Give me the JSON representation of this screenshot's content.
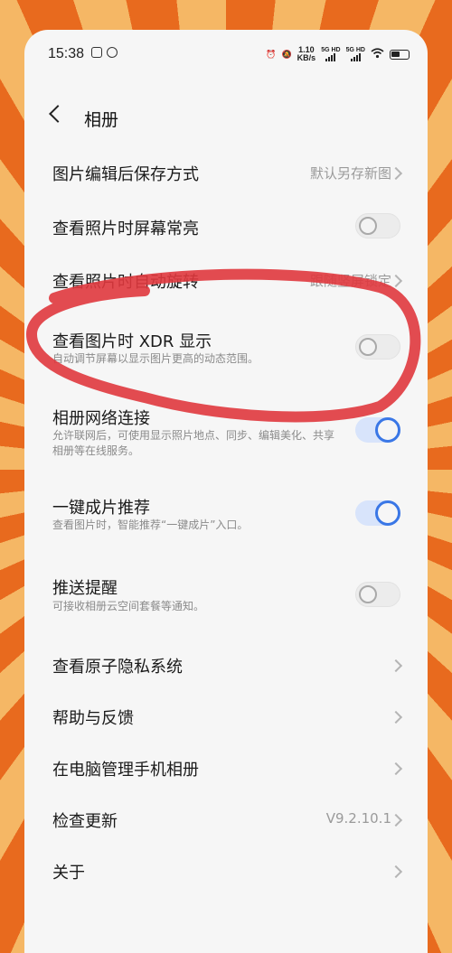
{
  "status_bar": {
    "time": "15:38",
    "speed_value": "1.10",
    "speed_unit": "KB/s",
    "sim1_label": "5G HD",
    "sim2_label": "5G HD"
  },
  "header": {
    "title": "相册"
  },
  "rows": [
    {
      "title": "图片编辑后保存方式",
      "value": "默认另存新图",
      "control": "chevron"
    },
    {
      "title": "查看照片时屏幕常亮",
      "control": "toggle",
      "checked": false
    },
    {
      "title": "查看照片时自动旋转",
      "value": "跟随竖屏锁定",
      "control": "chevron"
    },
    {
      "title": "查看图片时 XDR 显示",
      "subtitle": "自动调节屏幕以显示图片更高的动态范围。",
      "control": "toggle",
      "checked": false
    },
    {
      "title": "相册网络连接",
      "subtitle": "允许联网后，可使用显示照片地点、同步、编辑美化、共享相册等在线服务。",
      "control": "toggle",
      "checked": true
    },
    {
      "title": "一键成片推荐",
      "subtitle": "查看图片时，智能推荐“一键成片”入口。",
      "control": "toggle",
      "checked": true
    },
    {
      "title": "推送提醒",
      "subtitle": "可接收相册云空间套餐等通知。",
      "control": "toggle",
      "checked": false
    },
    {
      "title": "查看原子隐私系统",
      "control": "chevron"
    },
    {
      "title": "帮助与反馈",
      "control": "chevron"
    },
    {
      "title": "在电脑管理手机相册",
      "control": "chevron"
    },
    {
      "title": "检查更新",
      "value": "V9.2.10.1",
      "control": "chevron"
    },
    {
      "title": "关于",
      "control": "chevron"
    }
  ],
  "colors": {
    "background": "#f6f6f6",
    "toggle_on": "#3a77e6",
    "annotation": "#e0393e"
  }
}
